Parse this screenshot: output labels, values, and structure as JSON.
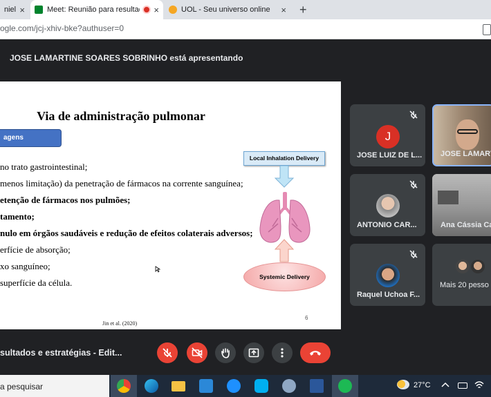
{
  "browser": {
    "tabs": [
      {
        "label": "niel",
        "close": "×"
      },
      {
        "label": "Meet: Reunião para resultado",
        "close": "×"
      },
      {
        "label": "UOL - Seu universo online",
        "close": "×"
      }
    ],
    "new_tab": "+",
    "url": "ogle.com/jcj-xhiv-bke?authuser=0"
  },
  "meet": {
    "presenting_banner": "JOSE LAMARTINE SOARES SOBRINHO está apresentando",
    "meeting_title": "sultados e estratégias - Edit...",
    "slide": {
      "title": "Via de administração pulmonar",
      "pill": "agens",
      "bullets": [
        {
          "text": " no trato gastrointestinal;",
          "bold": false
        },
        {
          "text": "menos limitação) da penetração de fármacos na corrente sanguínea;",
          "bold": false
        },
        {
          "text": "etenção de fármacos nos pulmões;",
          "bold": true
        },
        {
          "text": "tamento;",
          "bold": true
        },
        {
          "text": "nulo em órgãos saudáveis e redução de efeitos colaterais adversos;",
          "bold": true
        },
        {
          "text": "erfície de absorção;",
          "bold": false
        },
        {
          "text": "xo sanguíneo;",
          "bold": false
        },
        {
          "text": " superfície da célula.",
          "bold": false
        }
      ],
      "citation": "Jin et al. (2020)",
      "page_number": "6",
      "diagram": {
        "top_label": "Local Inhalation Delivery",
        "bottom_label": "Systemic Delivery"
      }
    },
    "participants": [
      {
        "name": "JOSE LUIZ DE L...",
        "initial": "J",
        "avatar_color": "#d93025"
      },
      {
        "name": "JOSE LAMART"
      },
      {
        "name": "ANTONIO CAR..."
      },
      {
        "name": "Ana Cássia Ca"
      },
      {
        "name": "Raquel Uchoa F..."
      },
      {
        "name": "Mais 20 pesso"
      }
    ]
  },
  "taskbar": {
    "search_placeholder": "a pesquisar",
    "temperature": "27°C"
  }
}
